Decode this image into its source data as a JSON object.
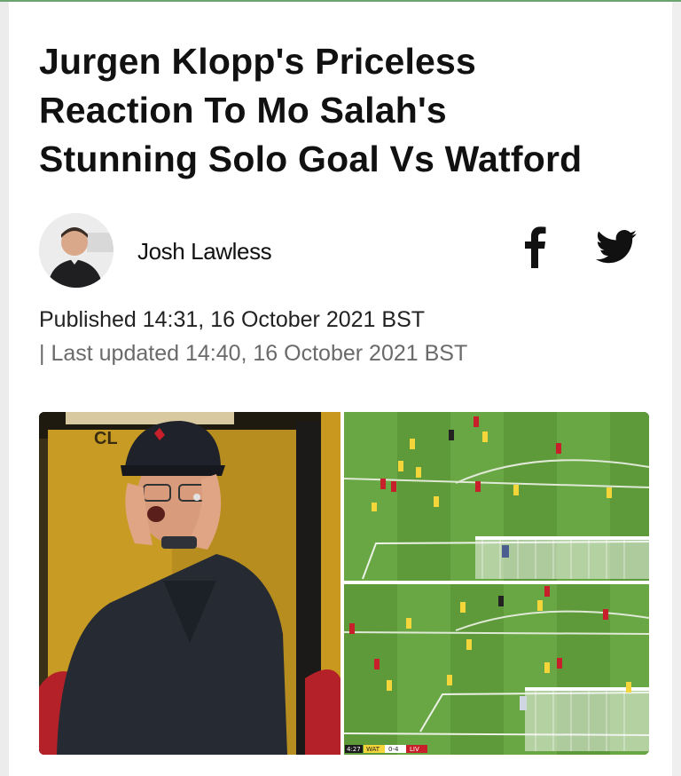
{
  "article": {
    "headline_lines": [
      "Jurgen Klopp's Priceless",
      "Reaction To Mo Salah's",
      "Stunning Solo Goal Vs Watford"
    ],
    "author": {
      "name": "Josh Lawless",
      "avatar_icon": "author-photo"
    },
    "share": {
      "facebook_glyph": "f",
      "facebook_icon": "facebook-icon",
      "twitter_icon": "twitter-bird-icon"
    },
    "published": "Published 14:31, 16 October 2021 BST",
    "updated": "| Last updated 14:40, 16 October 2021 BST"
  },
  "hero_image": {
    "description_icon": "photo-collage",
    "scoreboard": {
      "clock": "4:27",
      "home": "WAT",
      "score": "0-4",
      "away": "LIV"
    },
    "colors": {
      "pitch": "#5e9a3a",
      "pitch_stripe": "#69a644",
      "liverpool_red": "#c8202a",
      "watford_yellow": "#f4d53a",
      "jacket": "#262b33"
    }
  }
}
